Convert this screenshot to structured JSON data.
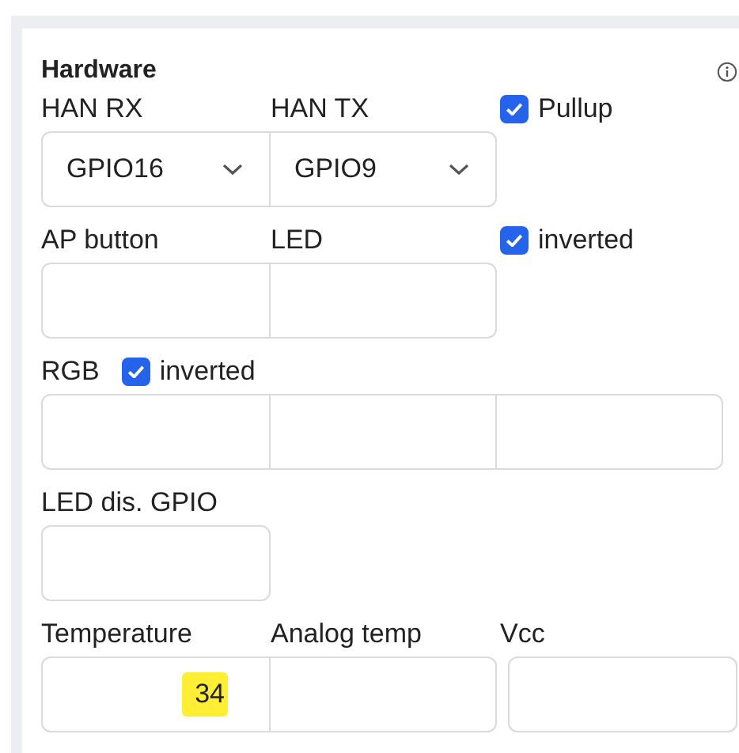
{
  "panel": {
    "title": "Hardware"
  },
  "rows": [
    {
      "header": [
        {
          "kind": "label",
          "text": "HAN RX"
        },
        {
          "kind": "label",
          "text": "HAN TX"
        },
        {
          "kind": "checkbox",
          "text": "Pullup",
          "checked": true
        }
      ],
      "groups": [
        [
          {
            "kind": "select",
            "value": "GPIO16"
          },
          {
            "kind": "select",
            "value": "GPIO9"
          }
        ]
      ]
    },
    {
      "header": [
        {
          "kind": "label",
          "text": "AP button"
        },
        {
          "kind": "label",
          "text": "LED"
        },
        {
          "kind": "checkbox",
          "text": "inverted",
          "checked": true
        }
      ],
      "groups": [
        [
          {
            "kind": "input"
          },
          {
            "kind": "input"
          }
        ]
      ]
    },
    {
      "header": [
        {
          "kind": "label",
          "text": "RGB"
        },
        {
          "kind": "inline_checkbox",
          "text": "inverted",
          "checked": true
        }
      ],
      "groups": [
        [
          {
            "kind": "input"
          },
          {
            "kind": "input"
          },
          {
            "kind": "input"
          }
        ]
      ]
    },
    {
      "header": [
        {
          "kind": "label",
          "text": "LED dis. GPIO"
        }
      ],
      "groups": [
        [
          {
            "kind": "input"
          }
        ]
      ]
    },
    {
      "header": [
        {
          "kind": "label",
          "text": "Temperature"
        },
        {
          "kind": "label",
          "text": "Analog temp"
        },
        {
          "kind": "label",
          "text": "Vcc"
        }
      ],
      "groups": [
        [
          {
            "kind": "input",
            "value": "34",
            "highlighted": true
          },
          {
            "kind": "input"
          }
        ],
        [
          {
            "kind": "input"
          }
        ]
      ]
    }
  ]
}
